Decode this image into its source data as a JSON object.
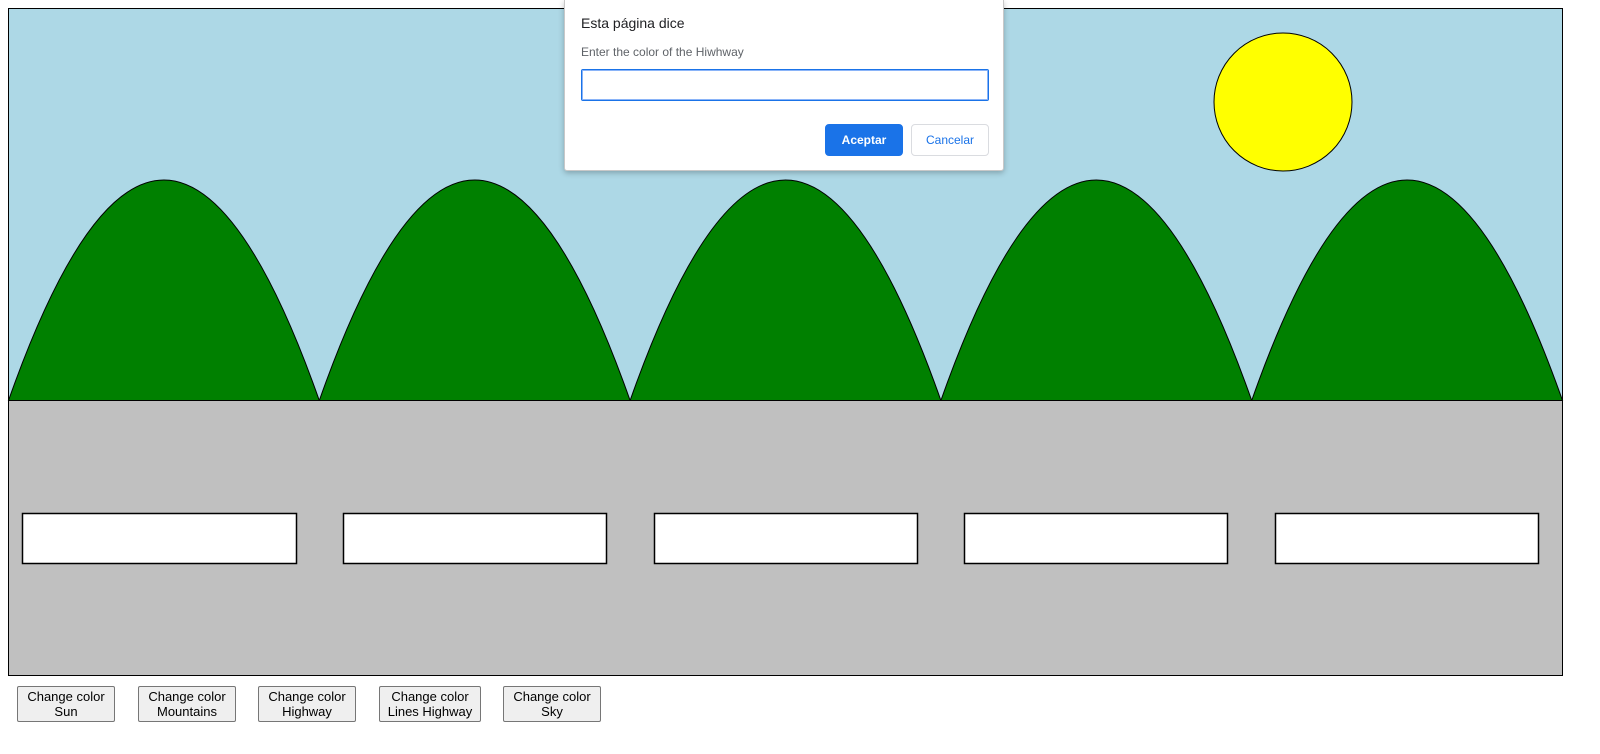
{
  "colors": {
    "sky": "#add8e6",
    "sun": "#ffff00",
    "mountains": "#008000",
    "highway": "#c0c0c0",
    "lines_highway": "#ffffff",
    "outline": "#000000",
    "accent": "#1a73e8"
  },
  "scene": {
    "mountain_count": 5,
    "lane_line_count": 5
  },
  "controls": [
    {
      "line1": "Change color",
      "line2": "Sun"
    },
    {
      "line1": "Change color",
      "line2": "Mountains"
    },
    {
      "line1": "Change color",
      "line2": "Highway"
    },
    {
      "line1": "Change color",
      "line2": "Lines Highway"
    },
    {
      "line1": "Change color",
      "line2": "Sky"
    }
  ],
  "dialog": {
    "title": "Esta página dice",
    "message": "Enter the color of the Hiwhway",
    "input_value": "",
    "ok_label": "Aceptar",
    "cancel_label": "Cancelar"
  }
}
